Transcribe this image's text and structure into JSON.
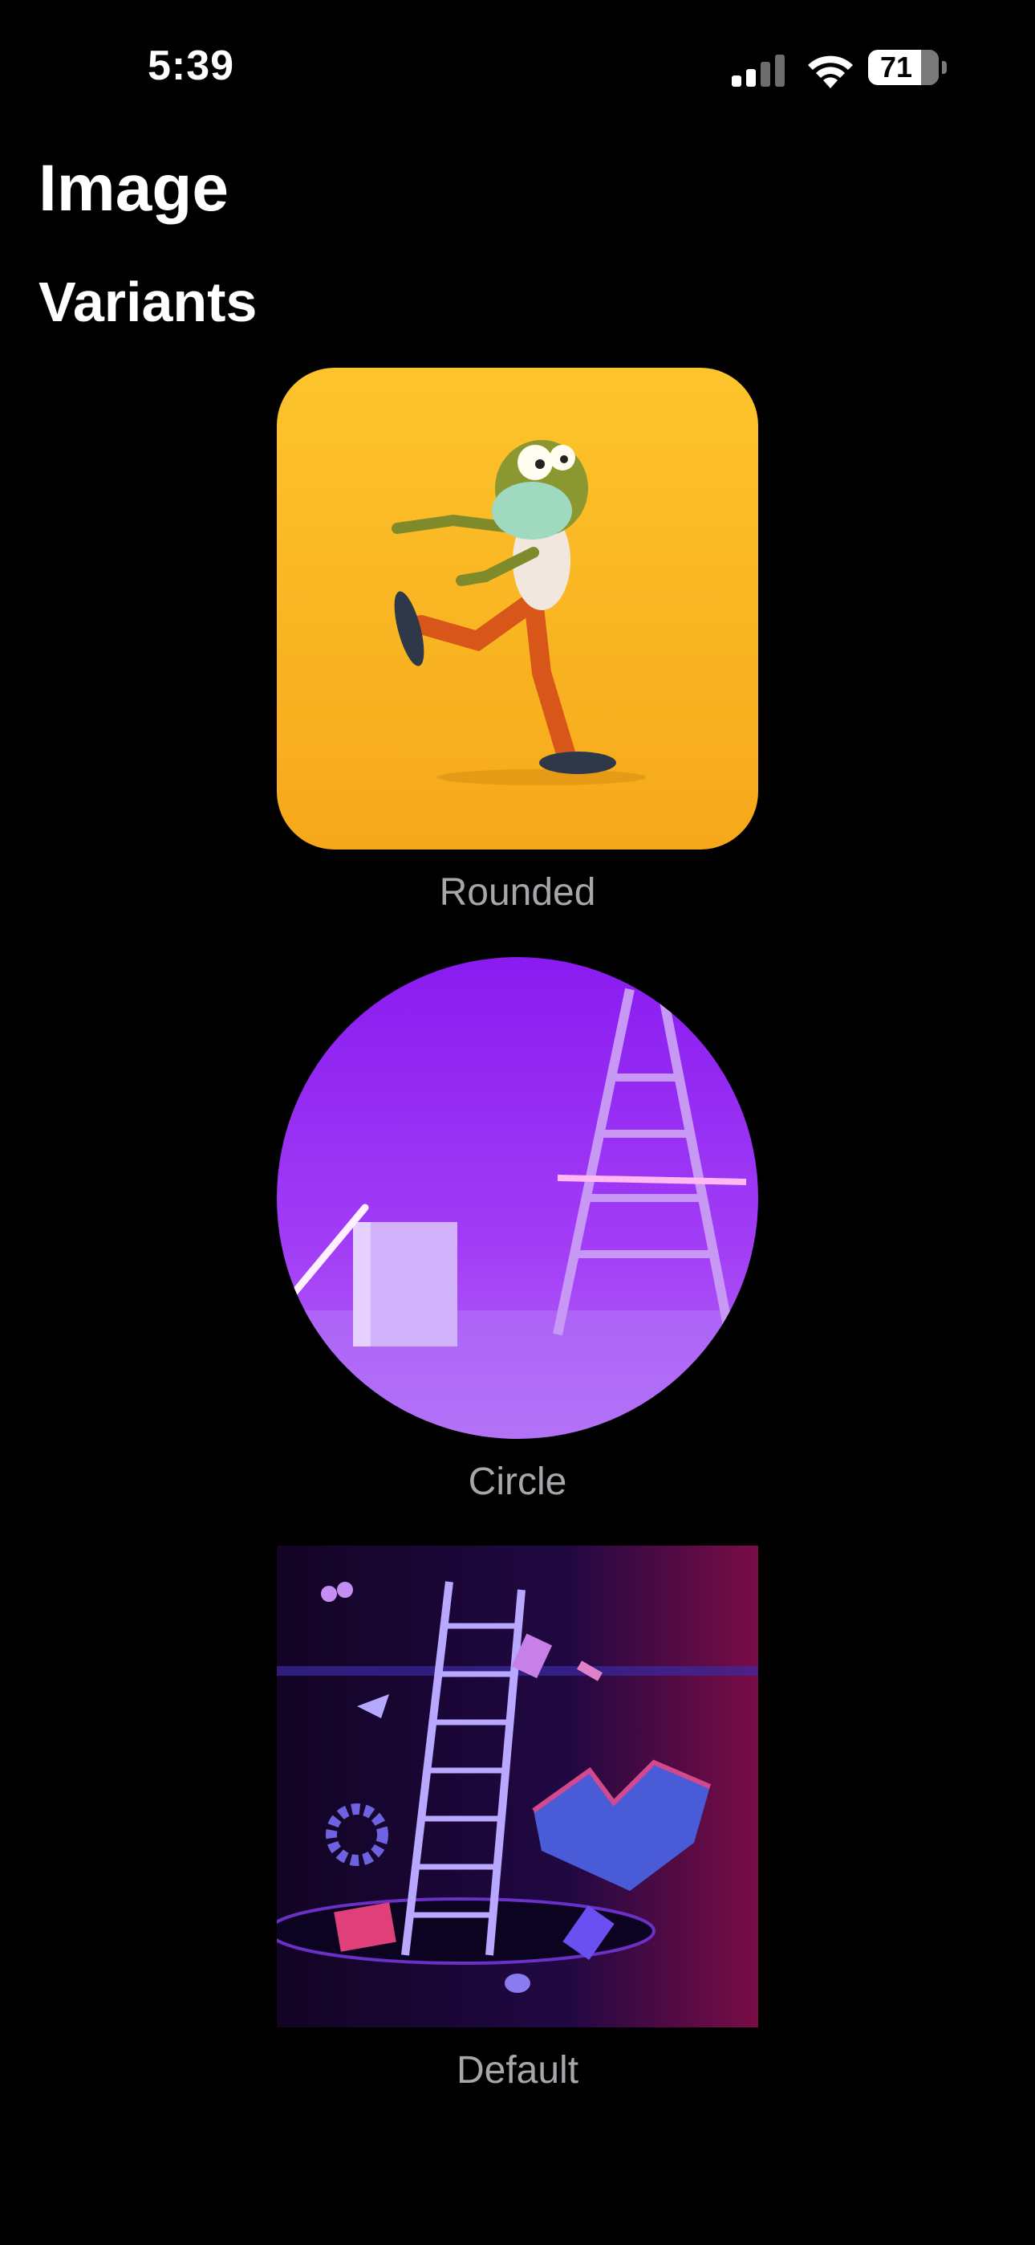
{
  "status_bar": {
    "time": "5:39",
    "battery_level": "71",
    "icons": [
      "signal-icon",
      "wifi-icon",
      "battery-icon"
    ]
  },
  "header": {
    "title": "Image"
  },
  "section": {
    "title": "Variants"
  },
  "variants": [
    {
      "caption": "Rounded",
      "shape": "rounded",
      "image": "zombie-character-illustration",
      "background": "#FDB925"
    },
    {
      "caption": "Circle",
      "shape": "circle",
      "image": "purple-ladder-neon-scene",
      "background": "#9A2BF5"
    },
    {
      "caption": "Default",
      "shape": "square",
      "image": "floating-objects-ladder-scene",
      "background": "#1A0830"
    }
  ]
}
